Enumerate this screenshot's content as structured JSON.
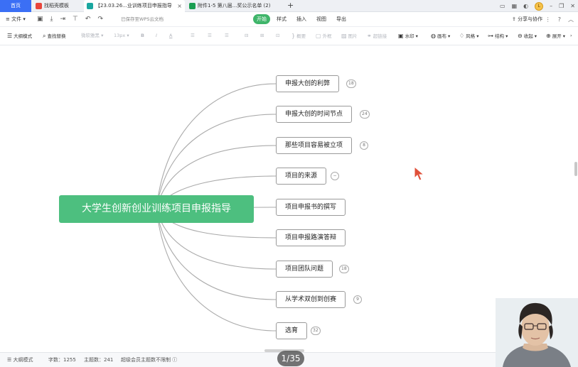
{
  "tabs": {
    "home": "首页",
    "items": [
      {
        "label": "找稻壳模板",
        "color": "#e8453c"
      },
      {
        "label": "【23.03.26...业训练项目申报指导",
        "color": "#1aa7a0"
      },
      {
        "label": "附件1-5 第八届...奖公示名单 (2)",
        "color": "#1b9e52"
      }
    ],
    "add": "+",
    "close": "×"
  },
  "window": {
    "avatar_letter": "L",
    "minimize": "–",
    "restore": "❐",
    "close": "✕"
  },
  "menubar": {
    "file": "文件",
    "saved": "已保存至WPS云文档",
    "tabs": [
      "开始",
      "样式",
      "插入",
      "视图",
      "导出"
    ],
    "active_tab": "开始",
    "share": "分享与协作",
    "help": "?"
  },
  "toolbar": {
    "outline_mode": "大纲模式",
    "find_replace": "查找替换",
    "font": "微软雅黑",
    "size": "13px",
    "bold": "B",
    "italic": "I",
    "font_color": "A",
    "summary": "概要",
    "frame": "外框",
    "image": "图片",
    "hyperlink": "超链接",
    "watermark": "水印",
    "canvas": "画布",
    "style": "风格",
    "structure": "结构",
    "collapse": "收起",
    "expand": "展开"
  },
  "mindmap": {
    "central": "大学生创新创业训练项目申报指导",
    "nodes": [
      {
        "label": "申报大创的利弊",
        "badge": "18"
      },
      {
        "label": "申报大创的时间节点",
        "badge": "24"
      },
      {
        "label": "那些项目容易被立项",
        "badge": "8"
      },
      {
        "label": "项目的来源",
        "badge": "−"
      },
      {
        "label": "项目申报书的撰写",
        "badge": ""
      },
      {
        "label": "项目申报路演答辩",
        "badge": ""
      },
      {
        "label": "项目团队问题",
        "badge": "18"
      },
      {
        "label": "从学术双创到创赛",
        "badge": "9"
      },
      {
        "label": "选育",
        "badge": "32"
      }
    ]
  },
  "statusbar": {
    "outline": "大纲模式",
    "word_count": "字数：1255",
    "topic_count": "主题数：241",
    "vip": "超级会员主题数不限制"
  },
  "pager": "1/35",
  "colors": {
    "accent": "#3fb56a",
    "central_bg": "#4dbf7f",
    "tab_active": "#3b6ff5"
  }
}
